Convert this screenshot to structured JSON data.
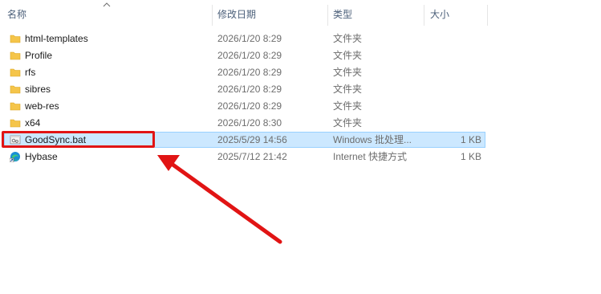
{
  "columns": {
    "name": "名称",
    "date": "修改日期",
    "type": "类型",
    "size": "大小"
  },
  "rows": [
    {
      "name": "html-templates",
      "date": "2026/1/20 8:29",
      "type": "文件夹",
      "size": "",
      "icon": "folder-icon"
    },
    {
      "name": "Profile",
      "date": "2026/1/20 8:29",
      "type": "文件夹",
      "size": "",
      "icon": "folder-icon"
    },
    {
      "name": "rfs",
      "date": "2026/1/20 8:29",
      "type": "文件夹",
      "size": "",
      "icon": "folder-icon"
    },
    {
      "name": "sibres",
      "date": "2026/1/20 8:29",
      "type": "文件夹",
      "size": "",
      "icon": "folder-icon"
    },
    {
      "name": "web-res",
      "date": "2026/1/20 8:29",
      "type": "文件夹",
      "size": "",
      "icon": "folder-icon"
    },
    {
      "name": "x64",
      "date": "2026/1/20 8:30",
      "type": "文件夹",
      "size": "",
      "icon": "folder-icon"
    },
    {
      "name": "GoodSync.bat",
      "date": "2025/5/29 14:56",
      "type": "Windows 批处理...",
      "size": "1 KB",
      "icon": "batch-file-icon",
      "selected": true
    },
    {
      "name": "Hybase",
      "date": "2025/7/12 21:42",
      "type": "Internet 快捷方式",
      "size": "1 KB",
      "icon": "edge-shortcut-icon"
    }
  ],
  "colors": {
    "folder": "#f5c54a",
    "selection_bg": "#cce8ff",
    "annotation_red": "#e11414"
  }
}
